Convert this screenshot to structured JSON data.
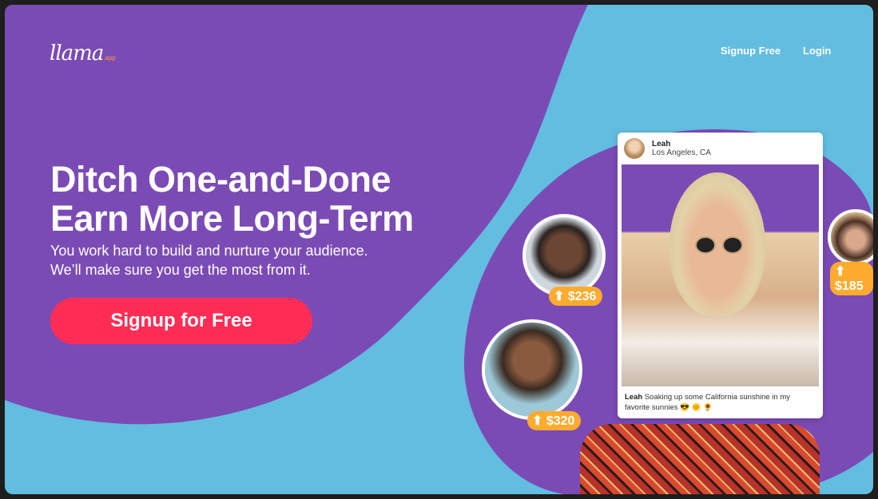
{
  "logo": {
    "text": "llama",
    "suffix": ".app"
  },
  "nav": {
    "signup": "Signup Free",
    "login": "Login"
  },
  "hero": {
    "title_line1": "Ditch One-and-Done",
    "title_line2": "Earn More Long-Term",
    "subtitle_line1": "You work hard to build and nurture your audience.",
    "subtitle_line2": "We’ll make sure you get the most from it.",
    "cta": "Signup for Free"
  },
  "post": {
    "name": "Leah",
    "location": "Los Angeles, CA",
    "caption_user": "Leah",
    "caption": " Soaking up some California sunshine in my favorite sunnies 😎 🌞 🌻"
  },
  "badges": [
    "⬆ $236",
    "⬆ $320",
    "⬆ $185"
  ],
  "colors": {
    "purple": "#7b4bb5",
    "blue": "#62bde0",
    "cta": "#ff2d55",
    "badge": "#ffab2e"
  }
}
